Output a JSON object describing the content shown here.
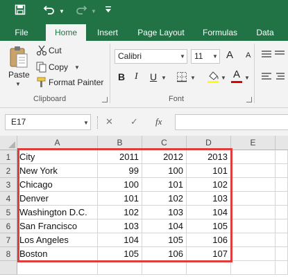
{
  "qat": {
    "save_icon": "save-icon",
    "undo_icon": "undo-icon",
    "redo_icon": "redo-icon",
    "customize_icon": "customize-qat-icon"
  },
  "tabs": [
    {
      "label": "File"
    },
    {
      "label": "Home"
    },
    {
      "label": "Insert"
    },
    {
      "label": "Page Layout"
    },
    {
      "label": "Formulas"
    },
    {
      "label": "Data"
    }
  ],
  "clipboard": {
    "paste_label": "Paste",
    "cut_label": "Cut",
    "copy_label": "Copy",
    "format_painter_label": "Format Painter",
    "group_label": "Clipboard"
  },
  "font": {
    "family": "Calibri",
    "size": "11",
    "group_label": "Font",
    "bold": "B",
    "italic": "I",
    "underline": "U",
    "font_color_letter": "A",
    "grow": "A",
    "shrink": "A"
  },
  "formula_bar": {
    "name_box": "E17",
    "cancel": "✕",
    "enter": "✓",
    "fx": "fx",
    "value": ""
  },
  "sheet": {
    "columns": [
      "A",
      "B",
      "C",
      "D",
      "E"
    ],
    "rows": [
      [
        "City",
        "2011",
        "2012",
        "2013",
        ""
      ],
      [
        "New York",
        "99",
        "100",
        "101",
        ""
      ],
      [
        "Chicago",
        "100",
        "101",
        "102",
        ""
      ],
      [
        "Denver",
        "101",
        "102",
        "103",
        ""
      ],
      [
        "Washington D.C.",
        "102",
        "103",
        "104",
        ""
      ],
      [
        "San Francisco",
        "103",
        "104",
        "105",
        ""
      ],
      [
        "Los Angeles",
        "104",
        "105",
        "106",
        ""
      ],
      [
        "Boston",
        "105",
        "106",
        "107",
        ""
      ]
    ],
    "highlight_color": "#e03c3c"
  },
  "colors": {
    "accent": "#217346"
  }
}
